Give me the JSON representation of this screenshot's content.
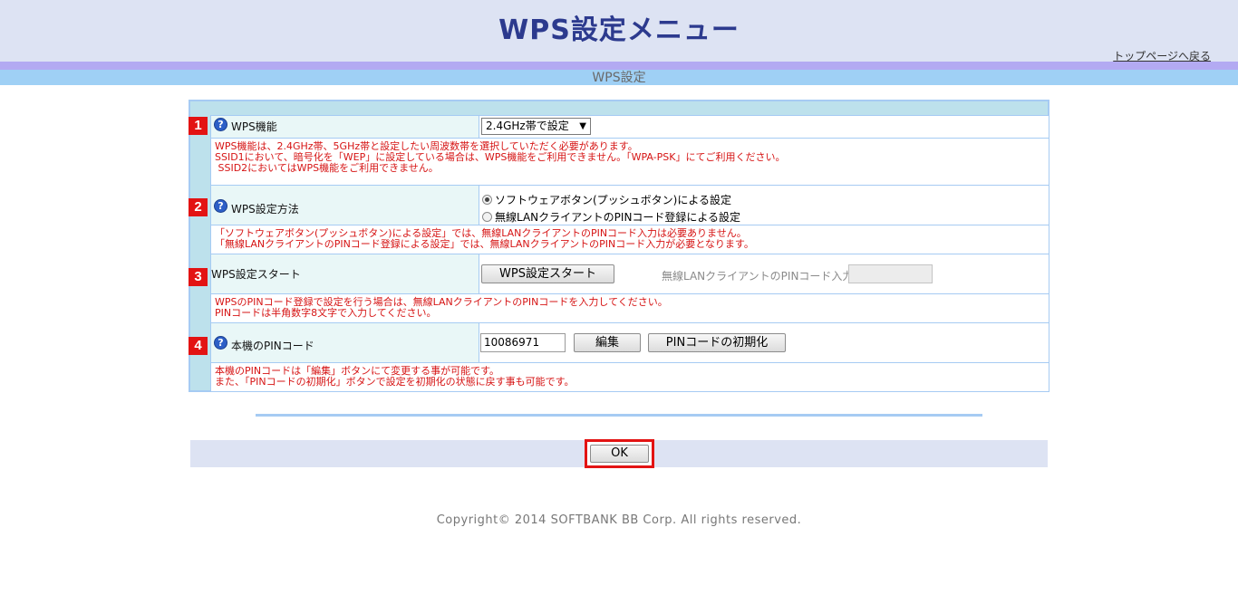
{
  "header": {
    "title": "WPS設定メニュー",
    "top_link": "トップページへ戻る",
    "section_title": "WPS設定"
  },
  "rows": [
    {
      "number": "1",
      "label": "WPS機能",
      "select_value": "2.4GHz帯で設定",
      "desc": "WPS機能は、2.4GHz帯、5GHz帯と設定したい周波数帯を選択していただく必要があります。\nSSID1において、暗号化を「WEP」に設定している場合は、WPS機能をご利用できません。「WPA-PSK」にてご利用ください。\n SSID2においてはWPS機能をご利用できません。"
    },
    {
      "number": "2",
      "label": "WPS設定方法",
      "radio_options": [
        "ソフトウェアボタン(プッシュボタン)による設定",
        "無線LANクライアントのPINコード登録による設定"
      ],
      "selected_index": 0,
      "desc": "「ソフトウェアボタン(プッシュボタン)による設定」では、無線LANクライアントのPINコード入力は必要ありません。\n「無線LANクライアントのPINコード登録による設定」では、無線LANクライアントのPINコード入力が必要となります。"
    },
    {
      "number": "3",
      "label": "WPS設定スタート",
      "start_button": "WPS設定スタート",
      "pin_input_label": "無線LANクライアントのPINコード入力",
      "pin_input_value": "",
      "desc": "WPSのPINコード登録で設定を行う場合は、無線LANクライアントのPINコードを入力してください。\nPINコードは半角数字8文字で入力してください。"
    },
    {
      "number": "4",
      "label": "本機のPINコード",
      "pin_value": "10086971",
      "edit_button": "編集",
      "reset_button": "PINコードの初期化",
      "desc": "本機のPINコードは「編集」ボタンにて変更する事が可能です。\nまた、「PINコードの初期化」ボタンで設定を初期化の状態に戻す事も可能です。"
    }
  ],
  "help_icon": "?",
  "footer": {
    "ok_label": "OK",
    "copyright": "Copyright© 2014 SOFTBANK BB Corp. All rights reserved."
  },
  "colors": {
    "title": "#2c3a8e",
    "badge": "#e31313",
    "desc_text": "#d61414",
    "panel_border": "#a6cbf3"
  }
}
